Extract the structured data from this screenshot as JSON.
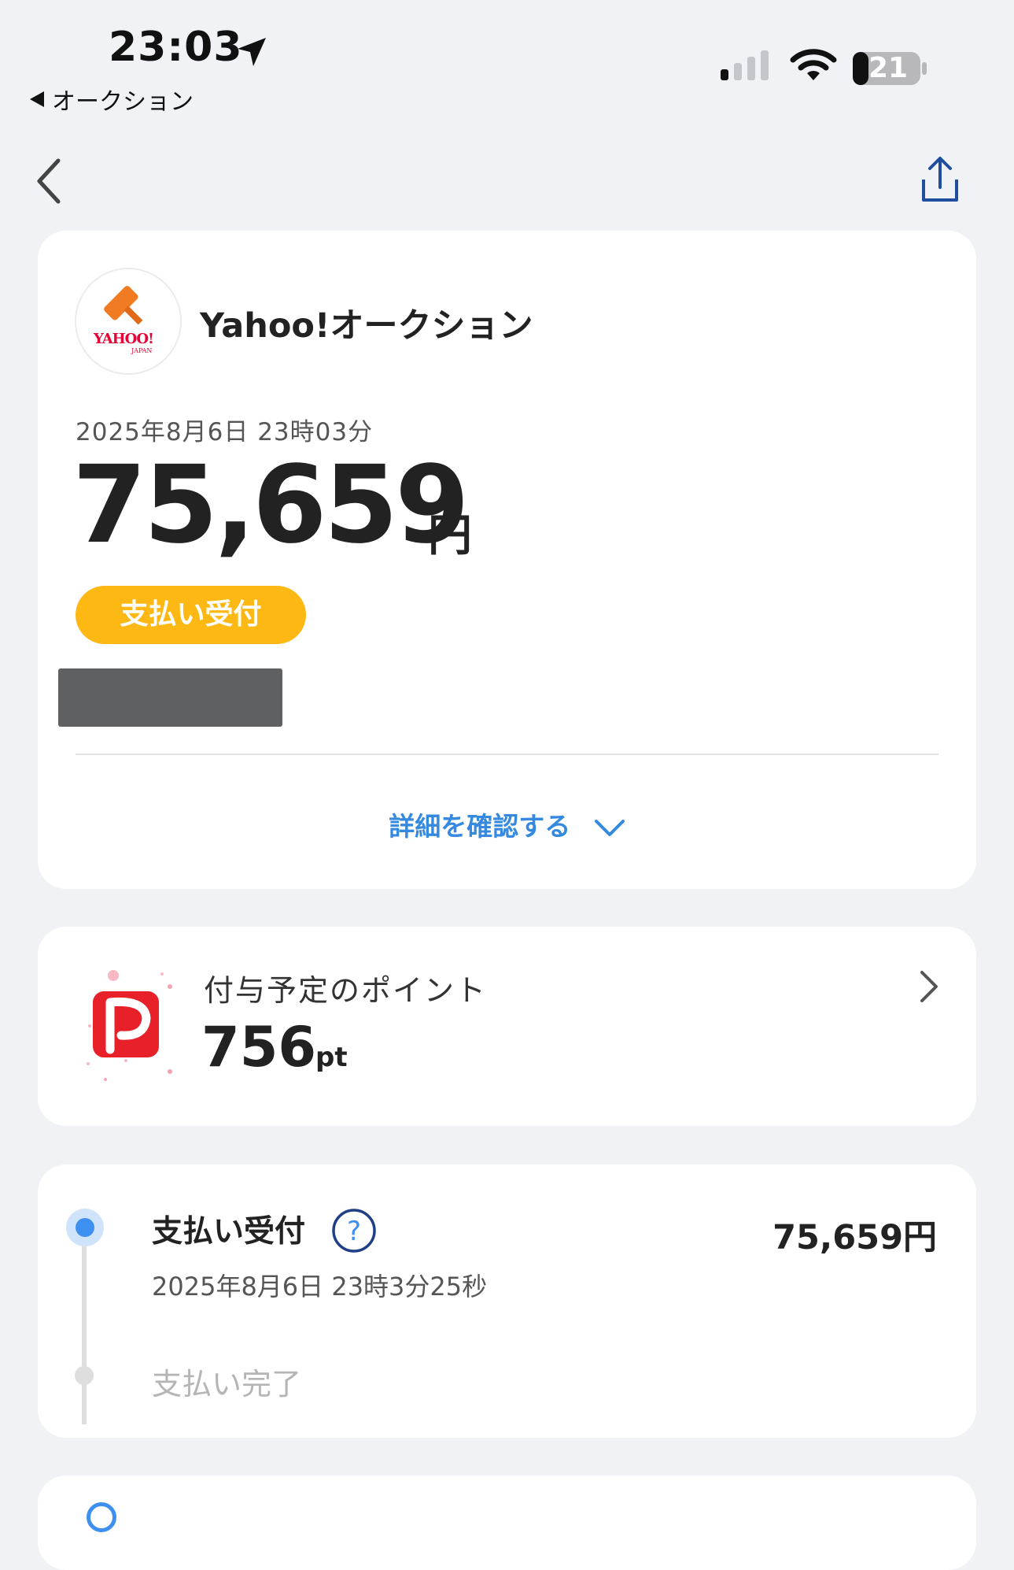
{
  "status_bar": {
    "time": "23:03",
    "back_app": "オークション",
    "battery": "21"
  },
  "merchant": {
    "name": "Yahoo!オークション",
    "logo_text": "YAHOO!",
    "logo_subtext": "JAPAN"
  },
  "transaction": {
    "datetime": "2025年8月6日 23時03分",
    "amount": "75,659",
    "currency": "円",
    "status": "支払い受付"
  },
  "details_link": "詳細を確認する",
  "points": {
    "label": "付与予定のポイント",
    "value": "756",
    "unit": "pt"
  },
  "timeline": {
    "step1": {
      "label": "支払い受付",
      "amount": "75,659円",
      "datetime": "2025年8月6日 23時3分25秒"
    },
    "step2": {
      "label": "支払い完了"
    }
  },
  "colors": {
    "background": "#f1f2f6",
    "status_pill": "#fdb813",
    "link_blue": "#3589de",
    "timeline_active": "#3d8ff0",
    "paypay_red": "#e8202a"
  },
  "icons": [
    "location-arrow-icon",
    "signal-icon",
    "wifi-icon",
    "battery-icon",
    "back-chevron-icon",
    "share-icon",
    "chevron-down-icon",
    "chevron-right-icon",
    "help-icon",
    "paypay-icon",
    "gavel-icon"
  ]
}
